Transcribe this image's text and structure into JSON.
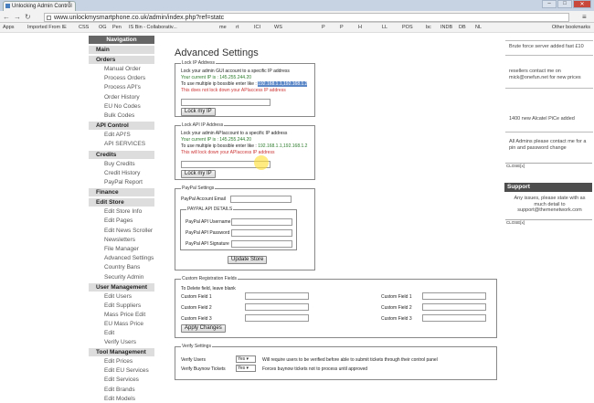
{
  "browser": {
    "tab_title": "Unlocking Admin Control",
    "url": "www.unlockmysmartphone.co.uk/admin/index.php?ref=statc",
    "bookmarks": [
      "Apps",
      "Imported From IE",
      "CSS",
      "OG",
      "Pen",
      "IS Bin - Collaborativ...",
      "me",
      "rt",
      "ICI",
      "WS",
      "P",
      "P",
      "H",
      "LL",
      "POS",
      "bc",
      "INDB",
      "DB",
      "NL"
    ],
    "other_bookmarks": "Other bookmarks",
    "window_buttons": [
      "–",
      "□",
      "✕"
    ]
  },
  "sidebar": {
    "navigation": "Navigation",
    "sections": [
      {
        "title": "Main",
        "items": []
      },
      {
        "title": "Orders",
        "items": [
          "Manual Order",
          "Process Orders",
          "Process API's",
          "Order History",
          "EU No Codes",
          "Bulk Codes"
        ]
      },
      {
        "title": "API Control",
        "items": [
          "Edit API'S",
          "API SERVICES"
        ]
      },
      {
        "title": "Credits",
        "items": [
          "Buy Credits",
          "Credit History",
          "PayPal Report"
        ]
      },
      {
        "title": "Finance",
        "items": []
      },
      {
        "title": "Edit Store",
        "items": [
          "Edit Store Info",
          "Edit Pages",
          "Edit News Scroller",
          "Newsletters",
          "File Manager",
          "Advanced Settings",
          "Country Bans",
          "Security Admin"
        ]
      },
      {
        "title": "User Management",
        "items": [
          "Edit Users",
          "Edit Suppliers",
          "Mass Price Edit",
          "EU Mass Price Edit",
          "Verify Users"
        ]
      },
      {
        "title": "Tool Management",
        "items": [
          "Edit Prices",
          "Edit EU Services",
          "Edit Services",
          "Edit Brands",
          "Edit Models"
        ]
      }
    ]
  },
  "main": {
    "title": "Advanced Settings",
    "lock_ip": {
      "legend": "Lock IP Address",
      "desc": "Lock your admin GUI account to a specific IP address",
      "current_ip": "Your current IP is : 145.255.244.20",
      "multi_prefix": "To use multiple ip bossible enter like : ",
      "multi_example": "192.168.1.1,192.168.1.2",
      "warning": "This does not lock down your APIaccess IP address",
      "button": "Lock my IP"
    },
    "lock_api": {
      "legend": "Lock API IP Address",
      "desc": "Lock your admin APIaccount to a specific IP address",
      "current_ip": "Your current IP is : 145.255.244.20",
      "multi_prefix": "To use multiple ip bossible enter like : ",
      "multi_example": "192.168.1.1,192.168.1.2",
      "warning": "This will lock down your APIaccess IP address",
      "button": "Lock my IP"
    },
    "paypal": {
      "legend": "PayPal Settings",
      "email_label": "PayPal Account Email",
      "api_legend": "PAYPAL API DETAILS",
      "username_label": "PayPal API Username",
      "password_label": "PayPal API Password",
      "signature_label": "PayPal API Signature",
      "button": "Update Store"
    },
    "custom": {
      "legend": "Custom Registration Fields",
      "note": "To Delete field, leave blank",
      "fields": [
        "Custom Field 1",
        "Custom Field 2",
        "Custom Field 3"
      ],
      "button": "Apply Changes"
    },
    "verify": {
      "legend": "Verify Settings",
      "rows": [
        {
          "label": "Verify Users",
          "value": "Yes",
          "note": "Will require users to be verified before able to submit tickets through their control panel"
        },
        {
          "label": "Verify Buynow Tickets",
          "value": "Yes",
          "note": "Forces buynow tickets not to process until approved"
        }
      ]
    }
  },
  "right": {
    "news": [
      "Brute force server added fast £10",
      "resellers contact me on mick@onefun.net for new prices",
      "1400 new Alcatel PiCe added",
      "All Admins please contact me for a pin and password change"
    ],
    "close": "CLOSE[x]",
    "support_title": "Support",
    "support_text": "Any issues, please state with as much detail to support@themenetwork.com"
  }
}
